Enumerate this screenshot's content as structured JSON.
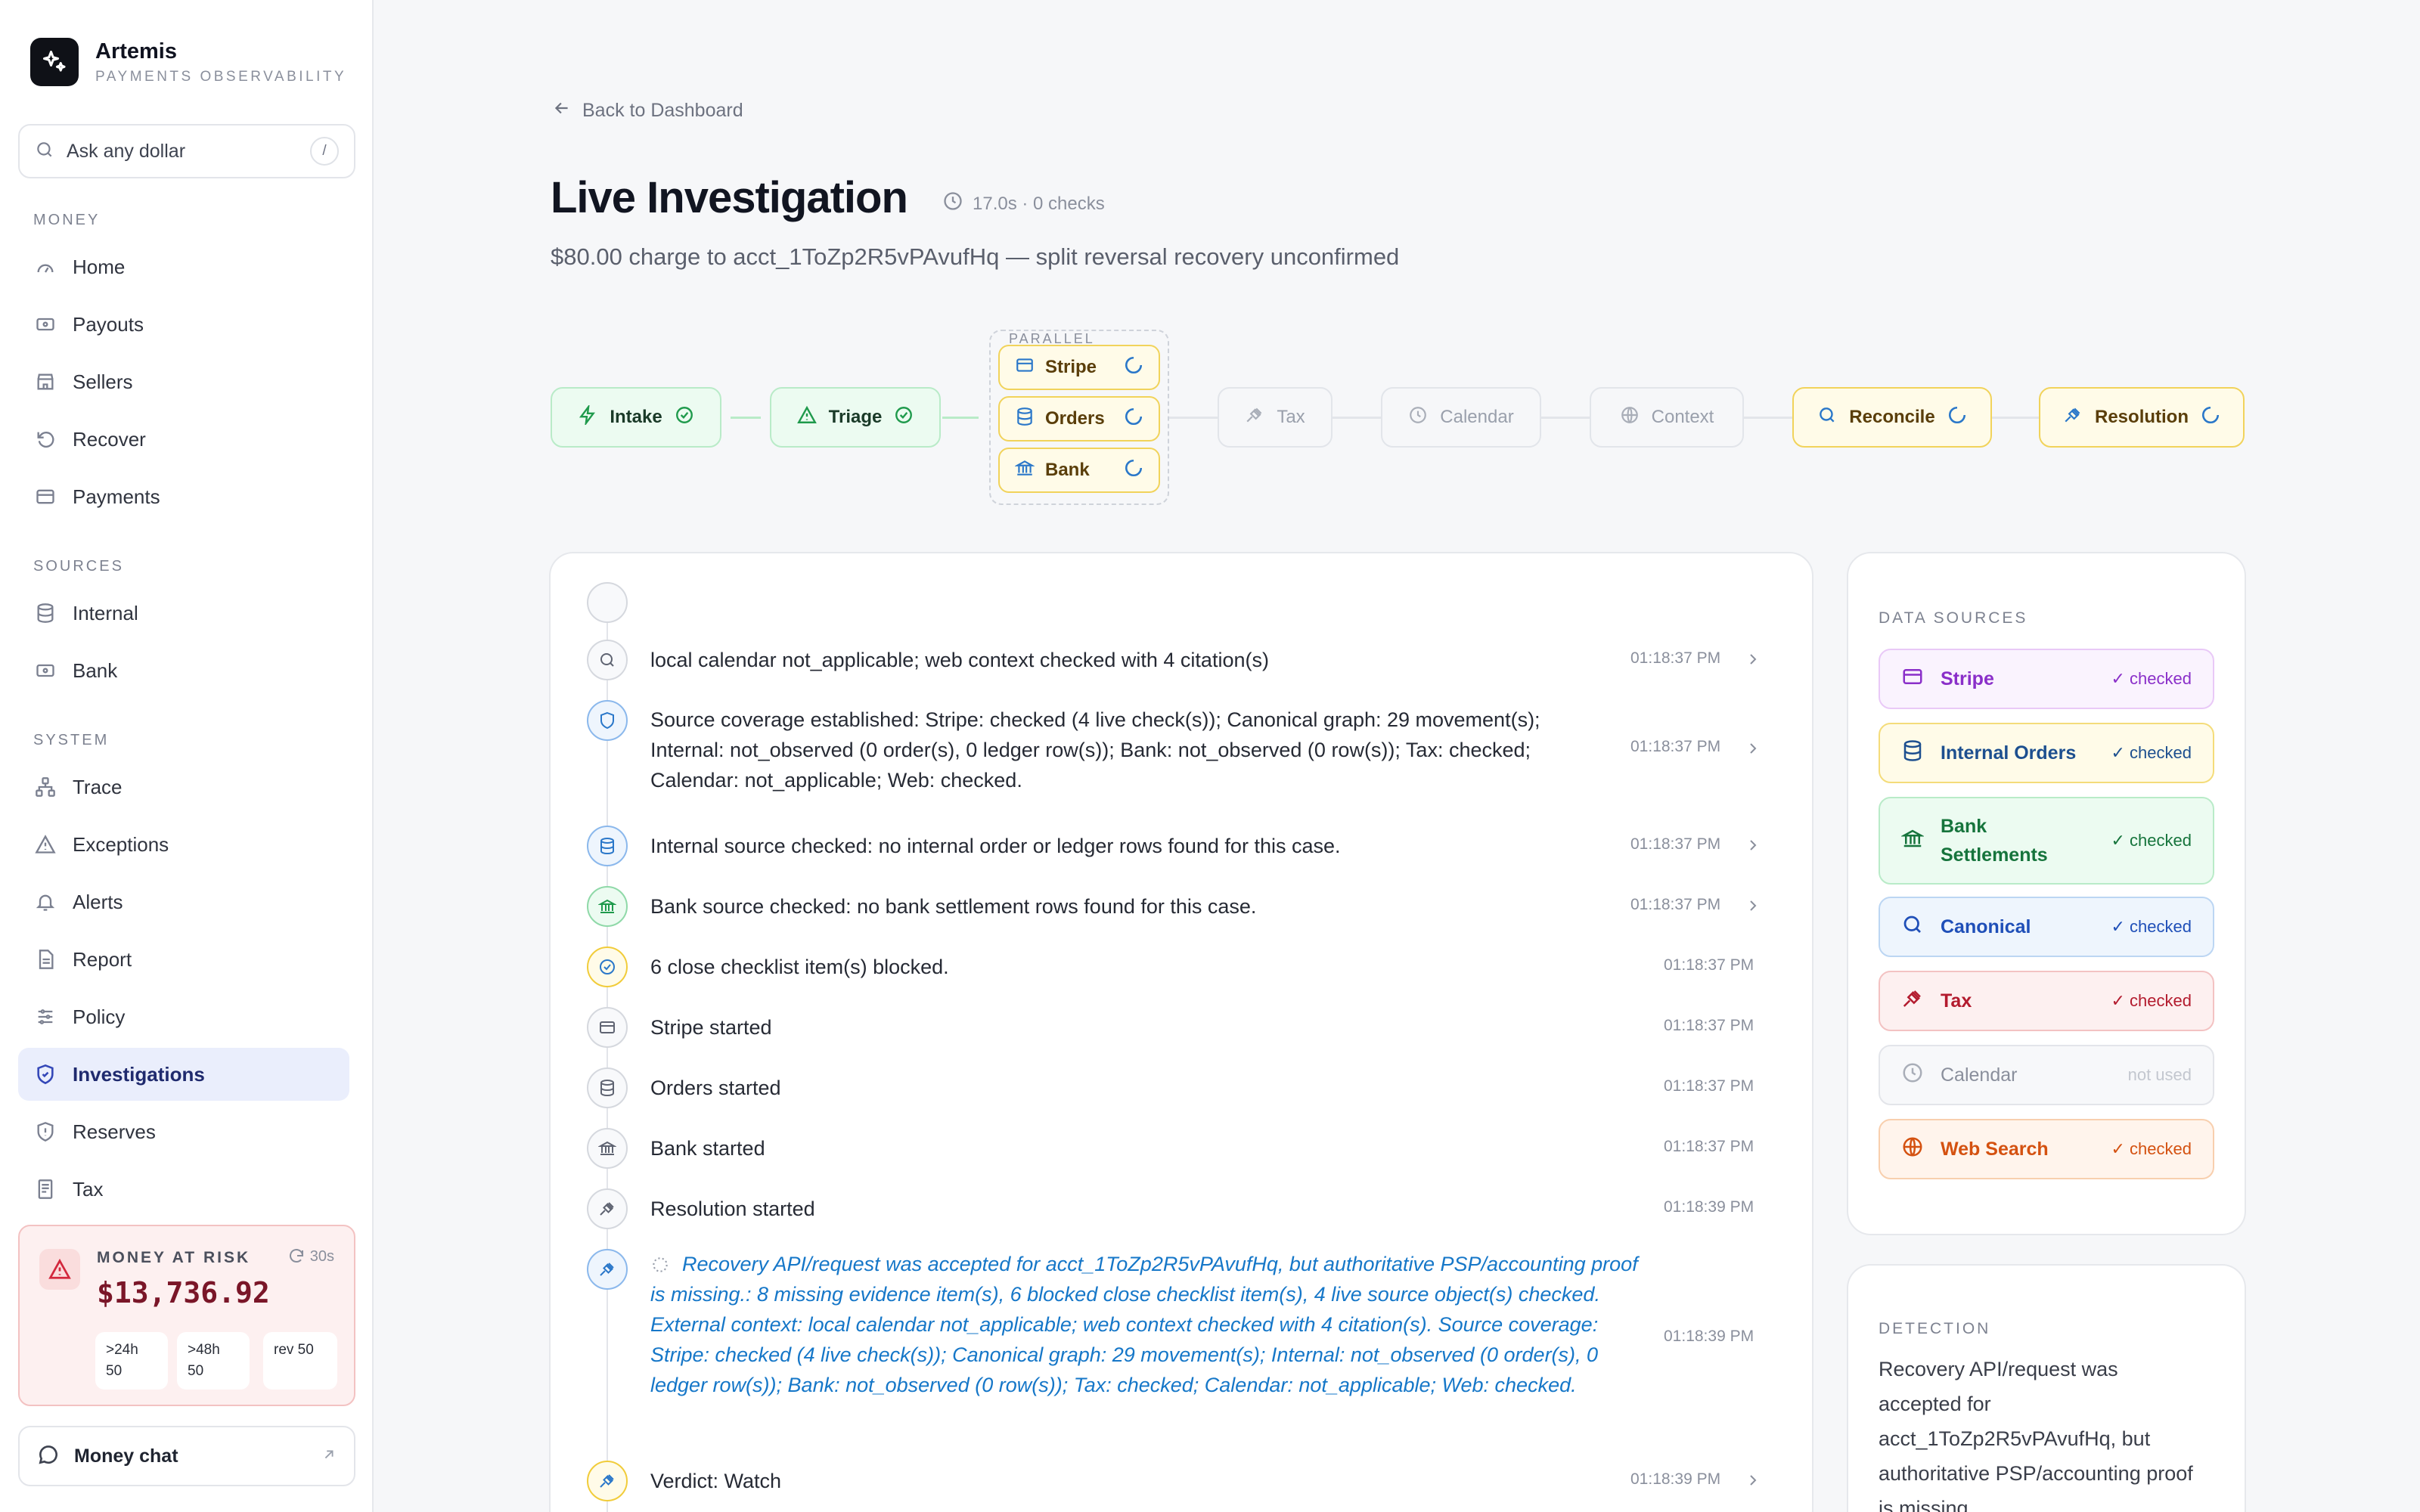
{
  "brand": {
    "name": "Artemis",
    "subtitle": "PAYMENTS OBSERVABILITY"
  },
  "search": {
    "placeholder": "Ask any dollar",
    "shortcut": "/"
  },
  "sidebar": {
    "money_label": "MONEY",
    "money_items": [
      {
        "label": "Home",
        "icon": "gauge-icon"
      },
      {
        "label": "Payouts",
        "icon": "banknote-icon"
      },
      {
        "label": "Sellers",
        "icon": "store-icon"
      },
      {
        "label": "Recover",
        "icon": "undo-icon"
      },
      {
        "label": "Payments",
        "icon": "card-icon"
      }
    ],
    "sources_label": "SOURCES",
    "source_items": [
      {
        "label": "Internal",
        "icon": "database-icon"
      },
      {
        "label": "Bank",
        "icon": "banknote-icon"
      }
    ],
    "system_label": "SYSTEM",
    "system_items": [
      {
        "label": "Trace",
        "icon": "sitemap-icon"
      },
      {
        "label": "Exceptions",
        "icon": "warning-icon"
      },
      {
        "label": "Alerts",
        "icon": "bell-icon"
      },
      {
        "label": "Report",
        "icon": "document-icon"
      },
      {
        "label": "Policy",
        "icon": "sliders-icon"
      },
      {
        "label": "Investigations",
        "icon": "shield-icon",
        "active": true
      },
      {
        "label": "Reserves",
        "icon": "shield-alert-icon"
      },
      {
        "label": "Tax",
        "icon": "receipt-icon"
      }
    ]
  },
  "risk": {
    "label": "MONEY AT RISK",
    "refresh": "30s",
    "amount": "$13,736.92",
    "pills": [
      {
        "line1": ">24h",
        "line2": "50"
      },
      {
        "line1": ">48h",
        "line2": "50"
      },
      {
        "line1": "rev 50",
        "line2": ""
      }
    ]
  },
  "chat": {
    "label": "Money chat"
  },
  "header": {
    "back": "Back to Dashboard",
    "title": "Live Investigation",
    "meta": "17.0s · 0 checks",
    "subtitle": "$80.00 charge to acct_1ToZp2R5vPAvufHq — split reversal recovery unconfirmed"
  },
  "pipeline": {
    "parallel_label": "PARALLEL",
    "stages": [
      {
        "label": "Intake",
        "state": "done"
      },
      {
        "label": "Triage",
        "state": "done"
      },
      {
        "label": "Tax",
        "state": "pending"
      },
      {
        "label": "Calendar",
        "state": "pending"
      },
      {
        "label": "Context",
        "state": "pending"
      },
      {
        "label": "Reconcile",
        "state": "running"
      },
      {
        "label": "Resolution",
        "state": "running"
      }
    ],
    "parallel": [
      {
        "label": "Stripe",
        "state": "running"
      },
      {
        "label": "Orders",
        "state": "running"
      },
      {
        "label": "Bank",
        "state": "running"
      }
    ]
  },
  "timeline": [
    {
      "text": "local calendar not_applicable; web context checked with 4 citation(s)",
      "time": "01:18:37 PM",
      "icon": "search-icon"
    },
    {
      "text": "Source coverage established: Stripe: checked (4 live check(s)); Canonical graph: 29 movement(s); Internal: not_observed (0 order(s), 0 ledger row(s)); Bank: not_observed (0 row(s)); Tax: checked; Calendar: not_applicable; Web: checked.",
      "time": "01:18:37 PM",
      "icon": "shield-icon"
    },
    {
      "text": "Internal source checked: no internal order or ledger rows found for this case.",
      "time": "01:18:37 PM",
      "icon": "database-icon"
    },
    {
      "text": "Bank source checked: no bank settlement rows found for this case.",
      "time": "01:18:37 PM",
      "icon": "bank-icon"
    },
    {
      "text": "6 close checklist item(s) blocked.",
      "time": "01:18:37 PM",
      "icon": "check-circle-icon"
    },
    {
      "text": "Stripe started",
      "time": "01:18:37 PM",
      "icon": "card-icon"
    },
    {
      "text": "Orders started",
      "time": "01:18:37 PM",
      "icon": "database-icon"
    },
    {
      "text": "Bank started",
      "time": "01:18:37 PM",
      "icon": "bank-icon"
    },
    {
      "text": "Resolution started",
      "time": "01:18:39 PM",
      "icon": "gavel-icon"
    },
    {
      "text": "Recovery API/request was accepted for acct_1ToZp2R5vPAvufHq, but authoritative PSP/accounting proof is missing.: 8 missing evidence item(s), 6 blocked close checklist item(s), 4 live source object(s) checked. External context: local calendar not_applicable; web context checked with 4 citation(s). Source coverage: Stripe: checked (4 live check(s)); Canonical graph: 29 movement(s); Internal: not_observed (0 order(s), 0 ledger row(s)); Bank: not_observed (0 row(s)); Tax: checked; Calendar: not_applicable; Web: checked.",
      "time": "01:18:39 PM",
      "icon": "gavel-icon"
    },
    {
      "text": "Verdict: Watch",
      "time": "01:18:39 PM",
      "icon": "gavel-icon"
    }
  ],
  "data_sources": {
    "title": "DATA SOURCES",
    "items": [
      {
        "label": "Stripe",
        "status": "✓ checked",
        "icon": "card-icon",
        "color": "#8a2fc9"
      },
      {
        "label": "Internal Orders",
        "status": "✓ checked",
        "icon": "database-icon",
        "color": "#1d4f8f"
      },
      {
        "label": "Bank Settlements",
        "status": "✓ checked",
        "icon": "bank-icon",
        "color": "#16743c"
      },
      {
        "label": "Canonical",
        "status": "✓ checked",
        "icon": "search-icon",
        "color": "#1f4fb8"
      },
      {
        "label": "Tax",
        "status": "✓ checked",
        "icon": "gavel-icon",
        "color": "#b31b2e"
      },
      {
        "label": "Calendar",
        "status": "not used",
        "icon": "clock-icon",
        "color": "#8a8f9c"
      },
      {
        "label": "Web Search",
        "status": "✓ checked",
        "icon": "globe-icon",
        "color": "#d45110"
      }
    ]
  },
  "detection": {
    "title": "DETECTION",
    "text": "Recovery API/request was accepted for acct_1ToZp2R5vPAvufHq, but authoritative PSP/accounting proof is missing."
  }
}
